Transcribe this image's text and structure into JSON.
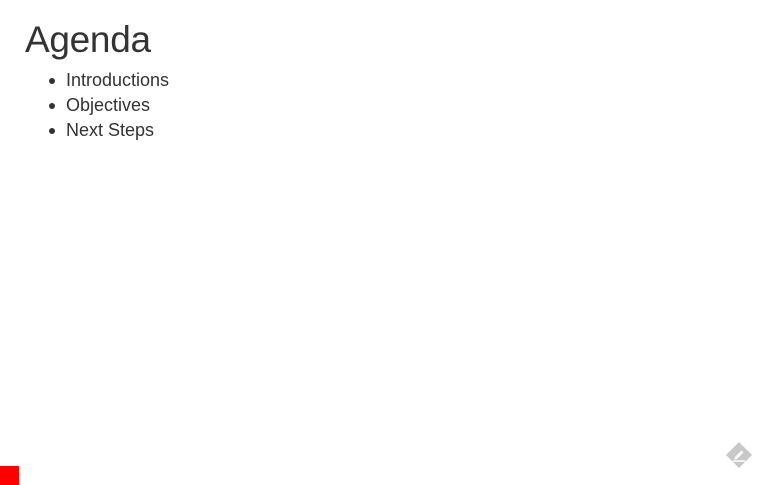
{
  "slide": {
    "title": "Agenda",
    "bullets": [
      "Introductions",
      "Objectives",
      "Next Steps"
    ]
  },
  "progress": {
    "color": "#ff0000"
  },
  "edit_control": {
    "icon": "pencil-diamond-icon",
    "color": "#c8c8c8"
  }
}
